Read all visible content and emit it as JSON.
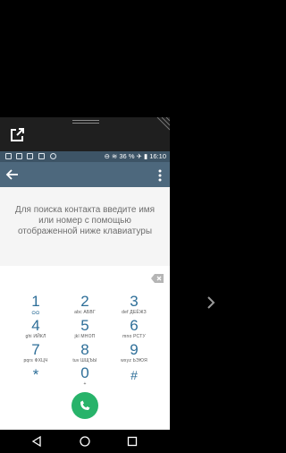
{
  "status": {
    "battery": "36 %",
    "time": "16:10"
  },
  "hint": {
    "text": "Для поиска контакта введите имя или номер с помощью отображенной ниже клавиатуры"
  },
  "dialpad": {
    "keys": [
      {
        "digit": "1",
        "sub": "o_o"
      },
      {
        "digit": "2",
        "sub": "abc АБВГ"
      },
      {
        "digit": "3",
        "sub": "def ДЕЁЖЗ"
      },
      {
        "digit": "4",
        "sub": "ghi ИЙКЛ"
      },
      {
        "digit": "5",
        "sub": "jkl МНОП"
      },
      {
        "digit": "6",
        "sub": "mno РСТУ"
      },
      {
        "digit": "7",
        "sub": "pqrs ФХЦЧ"
      },
      {
        "digit": "8",
        "sub": "tuv ШЩЪЫ"
      },
      {
        "digit": "9",
        "sub": "wxyz ЬЭЮЯ"
      },
      {
        "digit": "*",
        "sub": ""
      },
      {
        "digit": "0",
        "sub": "+"
      },
      {
        "digit": "#",
        "sub": ""
      }
    ]
  },
  "colors": {
    "toolbar": "#4d687d",
    "statusbar": "#3d5466",
    "accent": "#2d6e98",
    "call": "#28b36a"
  },
  "icons": [
    "open-external-icon",
    "back-arrow-icon",
    "overflow-menu-icon",
    "backspace-icon",
    "phone-icon",
    "nav-back-icon",
    "nav-home-icon",
    "nav-recents-icon",
    "chevron-right-icon"
  ]
}
